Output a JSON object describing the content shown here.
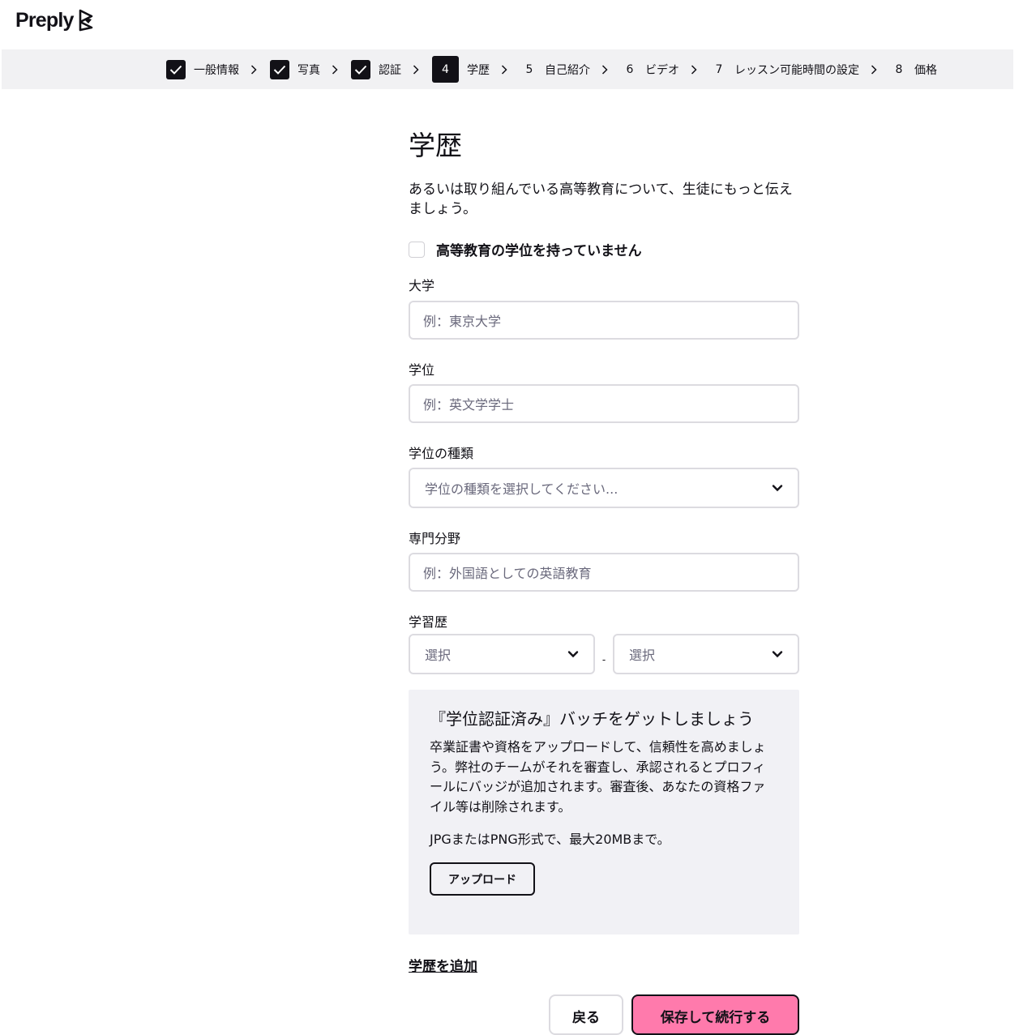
{
  "brand": {
    "name": "Preply"
  },
  "stepper": {
    "steps": [
      {
        "status": "done",
        "label": "一般情報"
      },
      {
        "status": "done",
        "label": "写真"
      },
      {
        "status": "done",
        "label": "認証"
      },
      {
        "status": "active",
        "number": "4",
        "label": "学歴"
      },
      {
        "status": "todo",
        "number": "5",
        "label": "自己紹介"
      },
      {
        "status": "todo",
        "number": "6",
        "label": "ビデオ"
      },
      {
        "status": "todo",
        "number": "7",
        "label": "レッスン可能時間の設定"
      },
      {
        "status": "todo",
        "number": "8",
        "label": "価格"
      }
    ]
  },
  "page": {
    "title": "学歴",
    "subtitle": "あるいは取り組んでいる高等教育について、生徒にもっと伝えましょう。",
    "no_degree_label": "高等教育の学位を持っていません"
  },
  "form": {
    "university": {
      "label": "大学",
      "placeholder": "例：東京大学"
    },
    "degree": {
      "label": "学位",
      "placeholder": "例：英文学学士"
    },
    "degree_type": {
      "label": "学位の種類",
      "placeholder": "学位の種類を選択してください..."
    },
    "specialization": {
      "label": "専門分野",
      "placeholder": "例：外国語としての英語教育"
    },
    "years": {
      "label": "学習歴",
      "from_placeholder": "選択",
      "separator": "-",
      "to_placeholder": "選択"
    }
  },
  "badge_card": {
    "title": "『学位認証済み』バッチをゲットしましょう",
    "body": "卒業証書や資格をアップロードして、信頼性を高めましょう。弊社のチームがそれを審査し、承認されるとプロフィールにバッジが追加されます。審査後、あなたの資格ファイル等は削除されます。",
    "note": "JPGまたはPNG形式で、最大20MBまで。",
    "upload_label": "アップロード"
  },
  "add_education_label": "学歴を追加",
  "actions": {
    "back_label": "戻る",
    "save_label": "保存して続行する"
  },
  "colors": {
    "primary": "#ff7aac",
    "text": "#121117",
    "stepper_bg": "#f1f1f3",
    "card_bg": "#f1f1f5"
  }
}
